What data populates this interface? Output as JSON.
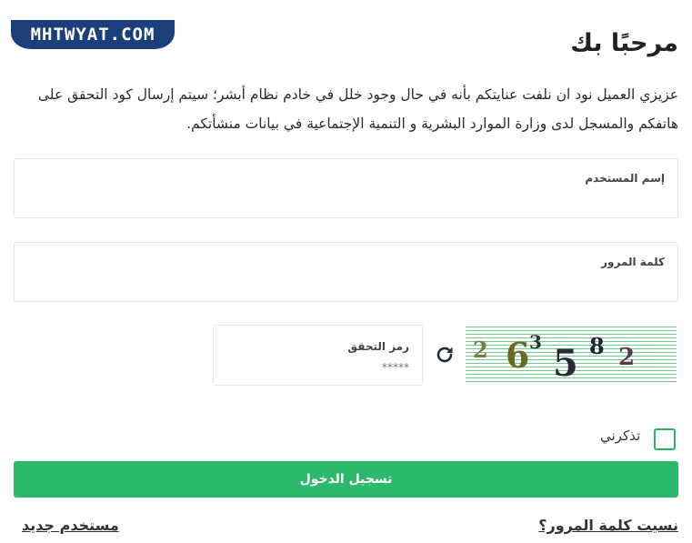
{
  "logo": {
    "text": "MHTWYAT.COM"
  },
  "header": {
    "title": "مرحبًا بك"
  },
  "intro": {
    "text": "عزيزي العميل نود ان نلفت عنايتكم بأنه في حال وجود خلل في خادم نظام أبشر؛ سيتم إرسال كود التحقق على هاتفكم والمسجل لدى وزارة الموارد البشرية و التنمية الإجتماعية في بيانات منشأتكم."
  },
  "form": {
    "username": {
      "label": "إسم المستخدم",
      "value": ""
    },
    "password": {
      "label": "كلمة المرور",
      "value": ""
    },
    "captcha": {
      "label": "رمز التحقق",
      "placeholder": "*****"
    },
    "captcha_image": {
      "chars": [
        "2",
        "6",
        "3",
        "5",
        "8",
        "2"
      ]
    },
    "remember": {
      "label": "تذكرني",
      "checked": false
    },
    "submit_label": "تسجيل الدخول"
  },
  "links": {
    "forgot_password": "نسيت كلمة المرور؟",
    "new_user": "مستخدم جديد"
  },
  "colors": {
    "accent": "#2db96a",
    "logo_bg": "#1b3f7a",
    "captcha_lines": "#73c98e"
  },
  "icons": {
    "refresh": "refresh-icon"
  }
}
